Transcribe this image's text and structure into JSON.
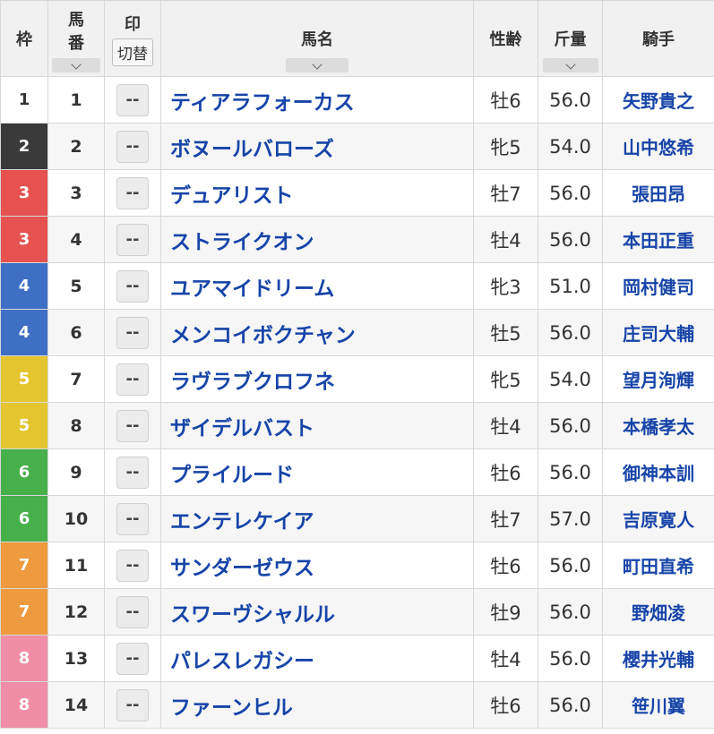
{
  "header": {
    "waku": "枠",
    "umaban_line1": "馬",
    "umaban_line2": "番",
    "mark": "印",
    "mark_toggle": "切替",
    "name": "馬名",
    "sexage": "性齢",
    "weight": "斤量",
    "jockey": "騎手"
  },
  "waku_colors": {
    "1": {
      "bg": "#ffffff",
      "fg": "#333333"
    },
    "2": {
      "bg": "#3a3a3a",
      "fg": "#ffffff"
    },
    "3": {
      "bg": "#e6524f",
      "fg": "#ffffff"
    },
    "4": {
      "bg": "#3f6fc5",
      "fg": "#ffffff"
    },
    "5": {
      "bg": "#e4c530",
      "fg": "#ffffff"
    },
    "6": {
      "bg": "#47b04b",
      "fg": "#ffffff"
    },
    "7": {
      "bg": "#ee9a3e",
      "fg": "#ffffff"
    },
    "8": {
      "bg": "#ef8ea5",
      "fg": "#ffffff"
    }
  },
  "rows": [
    {
      "waku": "1",
      "umaban": "1",
      "mark": "--",
      "name": "ティアラフォーカス",
      "sexage": "牡6",
      "weight": "56.0",
      "jockey": "矢野貴之"
    },
    {
      "waku": "2",
      "umaban": "2",
      "mark": "--",
      "name": "ボヌールバローズ",
      "sexage": "牝5",
      "weight": "54.0",
      "jockey": "山中悠希"
    },
    {
      "waku": "3",
      "umaban": "3",
      "mark": "--",
      "name": "デュアリスト",
      "sexage": "牡7",
      "weight": "56.0",
      "jockey": "張田昂"
    },
    {
      "waku": "3",
      "umaban": "4",
      "mark": "--",
      "name": "ストライクオン",
      "sexage": "牡4",
      "weight": "56.0",
      "jockey": "本田正重"
    },
    {
      "waku": "4",
      "umaban": "5",
      "mark": "--",
      "name": "ユアマイドリーム",
      "sexage": "牝3",
      "weight": "51.0",
      "jockey": "岡村健司"
    },
    {
      "waku": "4",
      "umaban": "6",
      "mark": "--",
      "name": "メンコイボクチャン",
      "sexage": "牡5",
      "weight": "56.0",
      "jockey": "庄司大輔"
    },
    {
      "waku": "5",
      "umaban": "7",
      "mark": "--",
      "name": "ラヴラブクロフネ",
      "sexage": "牝5",
      "weight": "54.0",
      "jockey": "望月洵輝"
    },
    {
      "waku": "5",
      "umaban": "8",
      "mark": "--",
      "name": "ザイデルバスト",
      "sexage": "牡4",
      "weight": "56.0",
      "jockey": "本橋孝太"
    },
    {
      "waku": "6",
      "umaban": "9",
      "mark": "--",
      "name": "プライルード",
      "sexage": "牡6",
      "weight": "56.0",
      "jockey": "御神本訓"
    },
    {
      "waku": "6",
      "umaban": "10",
      "mark": "--",
      "name": "エンテレケイア",
      "sexage": "牡7",
      "weight": "57.0",
      "jockey": "吉原寛人"
    },
    {
      "waku": "7",
      "umaban": "11",
      "mark": "--",
      "name": "サンダーゼウス",
      "sexage": "牡6",
      "weight": "56.0",
      "jockey": "町田直希"
    },
    {
      "waku": "7",
      "umaban": "12",
      "mark": "--",
      "name": "スワーヴシャルル",
      "sexage": "牡9",
      "weight": "56.0",
      "jockey": "野畑凌"
    },
    {
      "waku": "8",
      "umaban": "13",
      "mark": "--",
      "name": "パレスレガシー",
      "sexage": "牡4",
      "weight": "56.0",
      "jockey": "櫻井光輔"
    },
    {
      "waku": "8",
      "umaban": "14",
      "mark": "--",
      "name": "ファーンヒル",
      "sexage": "牡6",
      "weight": "56.0",
      "jockey": "笹川翼"
    }
  ]
}
